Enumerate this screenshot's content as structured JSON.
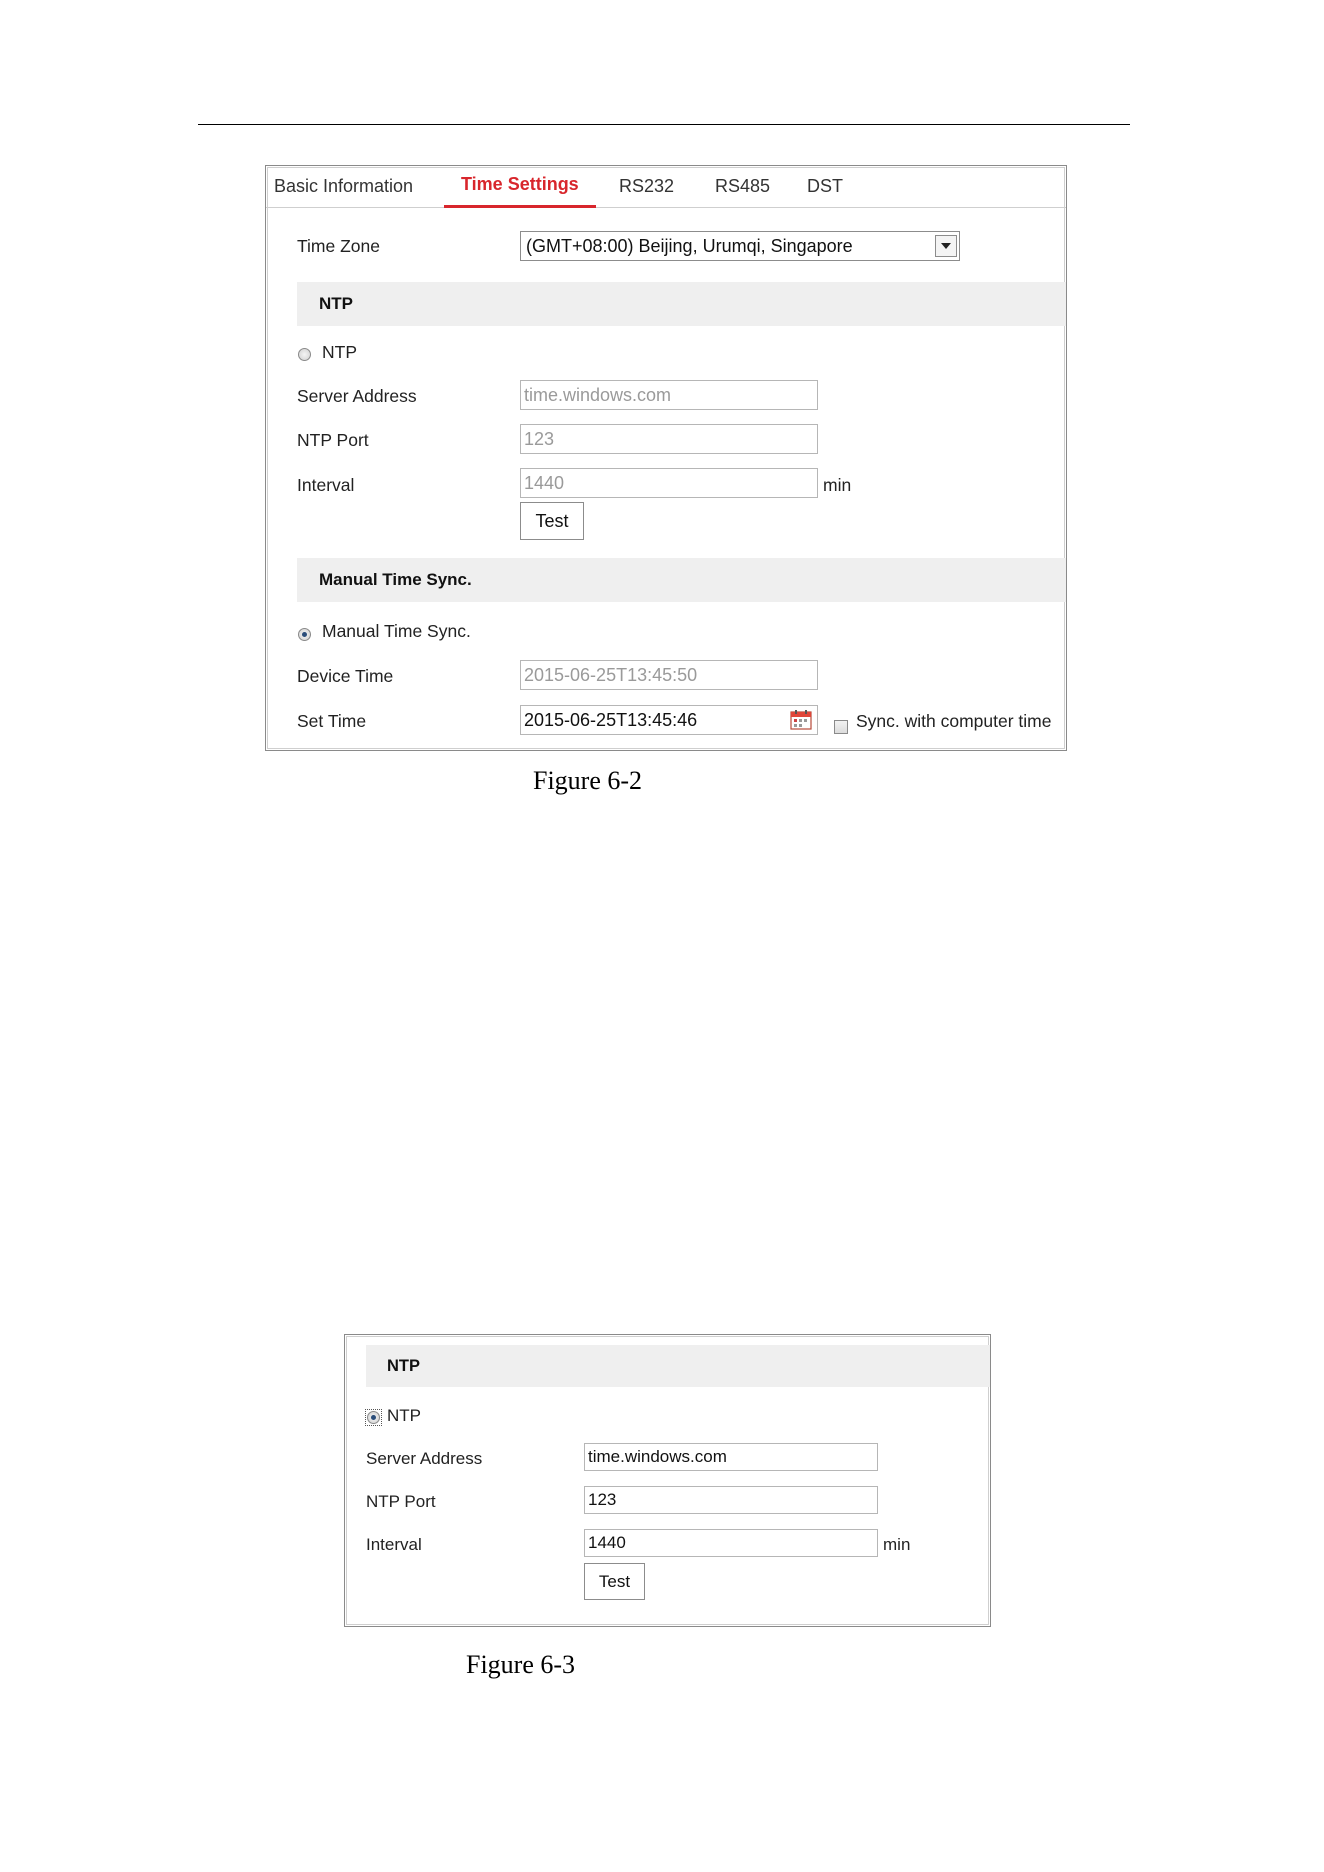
{
  "figure_6_2": {
    "tabs": [
      {
        "label": "Basic Information",
        "active": false
      },
      {
        "label": "Time Settings",
        "active": true
      },
      {
        "label": "RS232",
        "active": false
      },
      {
        "label": "RS485",
        "active": false
      },
      {
        "label": "DST",
        "active": false
      }
    ],
    "time_zone": {
      "label": "Time Zone",
      "value": "(GMT+08:00) Beijing, Urumqi, Singapore"
    },
    "ntp_section": {
      "title": "NTP",
      "radio_label": "NTP",
      "radio_selected": false,
      "server_address_label": "Server Address",
      "server_address_value": "time.windows.com",
      "ntp_port_label": "NTP Port",
      "ntp_port_value": "123",
      "interval_label": "Interval",
      "interval_value": "1440",
      "interval_unit": "min",
      "test_button": "Test"
    },
    "manual_section": {
      "title": "Manual Time Sync.",
      "radio_label": "Manual Time Sync.",
      "radio_selected": true,
      "device_time_label": "Device Time",
      "device_time_value": "2015-06-25T13:45:50",
      "set_time_label": "Set Time",
      "set_time_value": "2015-06-25T13:45:46",
      "sync_checkbox_label": "Sync. with computer time",
      "sync_checked": false
    },
    "caption": "Figure 6-2"
  },
  "figure_6_3": {
    "section_title": "NTP",
    "radio_label": "NTP",
    "radio_selected": true,
    "server_address_label": "Server Address",
    "server_address_value": "time.windows.com",
    "ntp_port_label": "NTP Port",
    "ntp_port_value": "123",
    "interval_label": "Interval",
    "interval_value": "1440",
    "interval_unit": "min",
    "test_button": "Test",
    "caption": "Figure 6-3"
  },
  "colors": {
    "active_tab": "#d8262c",
    "section_bg": "#efefef",
    "disabled_text": "#9a9a9a"
  },
  "icons": {
    "calendar": "calendar-icon",
    "dropdown": "chevron-down-icon"
  }
}
